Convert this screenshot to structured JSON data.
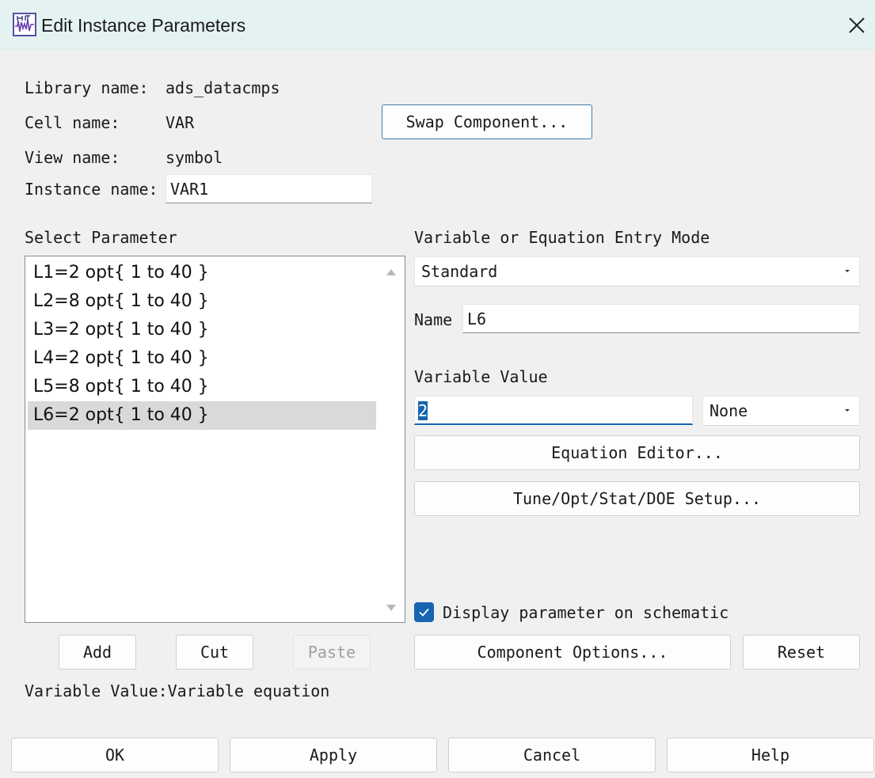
{
  "window": {
    "title": "Edit Instance Parameters"
  },
  "info": {
    "library_label": "Library name:",
    "library_value": "ads_datacmps",
    "cell_label": "Cell name:",
    "cell_value": "VAR",
    "view_label": "View name:",
    "view_value": "symbol",
    "instance_label": "Instance name:",
    "instance_value": "VAR1"
  },
  "buttons": {
    "swap_component": "Swap Component...",
    "add": "Add",
    "cut": "Cut",
    "paste": "Paste",
    "equation_editor": "Equation Editor...",
    "tune_setup": "Tune/Opt/Stat/DOE Setup...",
    "component_options": "Component Options...",
    "reset": "Reset",
    "ok": "OK",
    "apply": "Apply",
    "cancel": "Cancel",
    "help": "Help"
  },
  "select_parameter": {
    "label": "Select Parameter",
    "items": [
      {
        "label": "L1=2 opt{ 1 to 40 }",
        "selected": false
      },
      {
        "label": "L2=8 opt{ 1 to 40 }",
        "selected": false
      },
      {
        "label": "L3=2 opt{ 1 to 40 }",
        "selected": false
      },
      {
        "label": "L4=2 opt{ 1 to 40 }",
        "selected": false
      },
      {
        "label": "L5=8 opt{ 1 to 40 }",
        "selected": false
      },
      {
        "label": "L6=2 opt{ 1 to 40 }",
        "selected": true
      }
    ]
  },
  "entry_mode": {
    "label": "Variable or Equation Entry Mode",
    "value": "Standard"
  },
  "name": {
    "label": "Name",
    "value": "L6"
  },
  "variable_value": {
    "label": "Variable Value",
    "value": "2",
    "unit": "None"
  },
  "display_parameter": {
    "label": "Display parameter on schematic",
    "checked": true
  },
  "status_text": "Variable Value:Variable equation",
  "colors": {
    "accent": "#1565b0",
    "selection": "#d9d9d9",
    "titlebar": "#e4f3f2"
  }
}
